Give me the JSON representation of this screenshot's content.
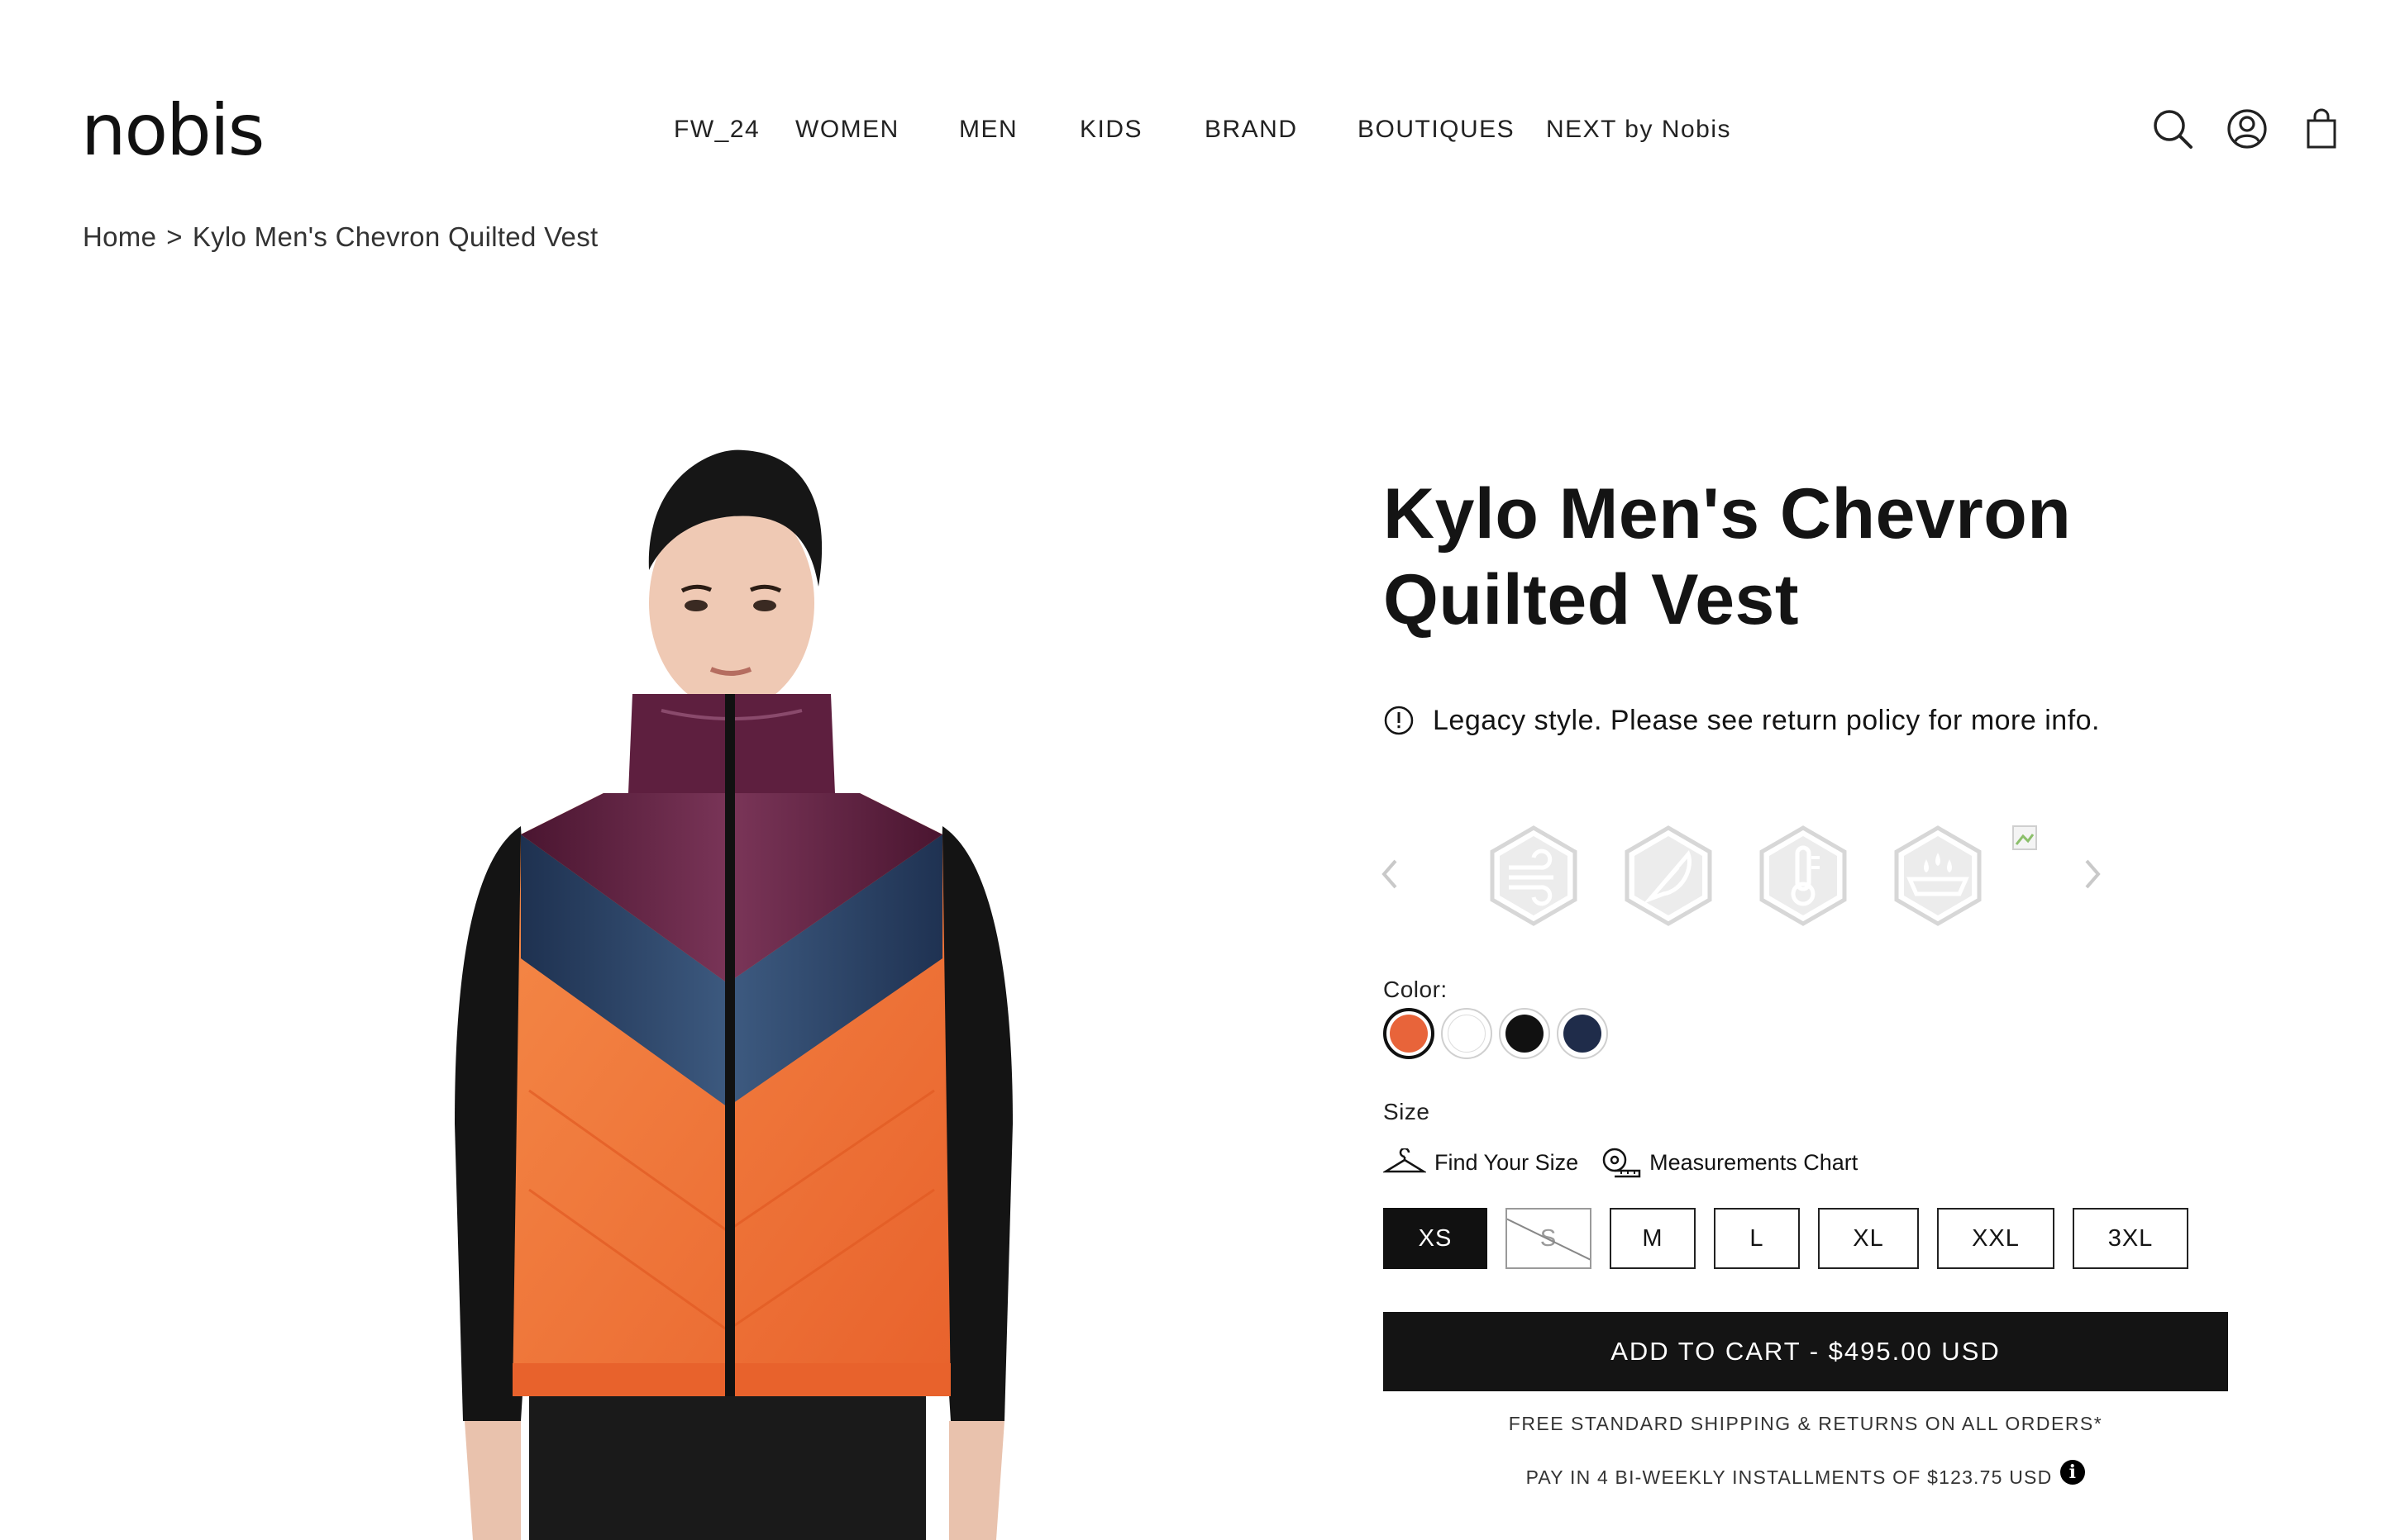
{
  "header": {
    "logo": "nobis",
    "nav": [
      {
        "label": "FW_24"
      },
      {
        "label": "WOMEN"
      },
      {
        "label": "MEN"
      },
      {
        "label": "KIDS"
      },
      {
        "label": "BRAND"
      },
      {
        "label": "BOUTIQUES"
      },
      {
        "label": "NEXT by Nobis"
      }
    ],
    "icons": [
      "search-icon",
      "account-icon",
      "shopping-bag-icon"
    ]
  },
  "breadcrumb": {
    "home": "Home",
    "separator": ">",
    "current": "Kylo Men's Chevron Quilted Vest"
  },
  "product": {
    "title": "Kylo Men's Chevron Quilted Vest",
    "notice": "Legacy style. Please see return policy for more info.",
    "feature_icons": [
      "wind-resistant-icon",
      "lightweight-feather-icon",
      "temperature-icon",
      "water-resistant-icon"
    ],
    "color_label": "Color:",
    "colors": [
      {
        "name": "orange",
        "hex": "#e8643a",
        "selected": true
      },
      {
        "name": "white",
        "hex": "#ffffff",
        "selected": false
      },
      {
        "name": "black",
        "hex": "#111111",
        "selected": false
      },
      {
        "name": "navy",
        "hex": "#1f2c4a",
        "selected": false
      }
    ],
    "size_label": "Size",
    "find_your_size": "Find Your Size",
    "measurements_chart": "Measurements Chart",
    "sizes": [
      {
        "label": "XS",
        "selected": true,
        "available": true
      },
      {
        "label": "S",
        "selected": false,
        "available": false
      },
      {
        "label": "M",
        "selected": false,
        "available": true
      },
      {
        "label": "L",
        "selected": false,
        "available": true
      },
      {
        "label": "XL",
        "selected": false,
        "available": true
      },
      {
        "label": "XXL",
        "selected": false,
        "available": true
      },
      {
        "label": "3XL",
        "selected": false,
        "available": true
      }
    ],
    "add_to_cart": "ADD TO CART - $495.00 USD",
    "shipping": "FREE STANDARD SHIPPING & RETURNS ON ALL ORDERS*",
    "installments": "PAY IN 4 BI-WEEKLY INSTALLMENTS OF $123.75 USD",
    "info_glyph": "i"
  },
  "colors": {
    "text": "#141414",
    "button": "#141414",
    "vest_orange": "#f07a3a",
    "vest_navy": "#2e4566",
    "vest_plum": "#5a1d3c"
  }
}
